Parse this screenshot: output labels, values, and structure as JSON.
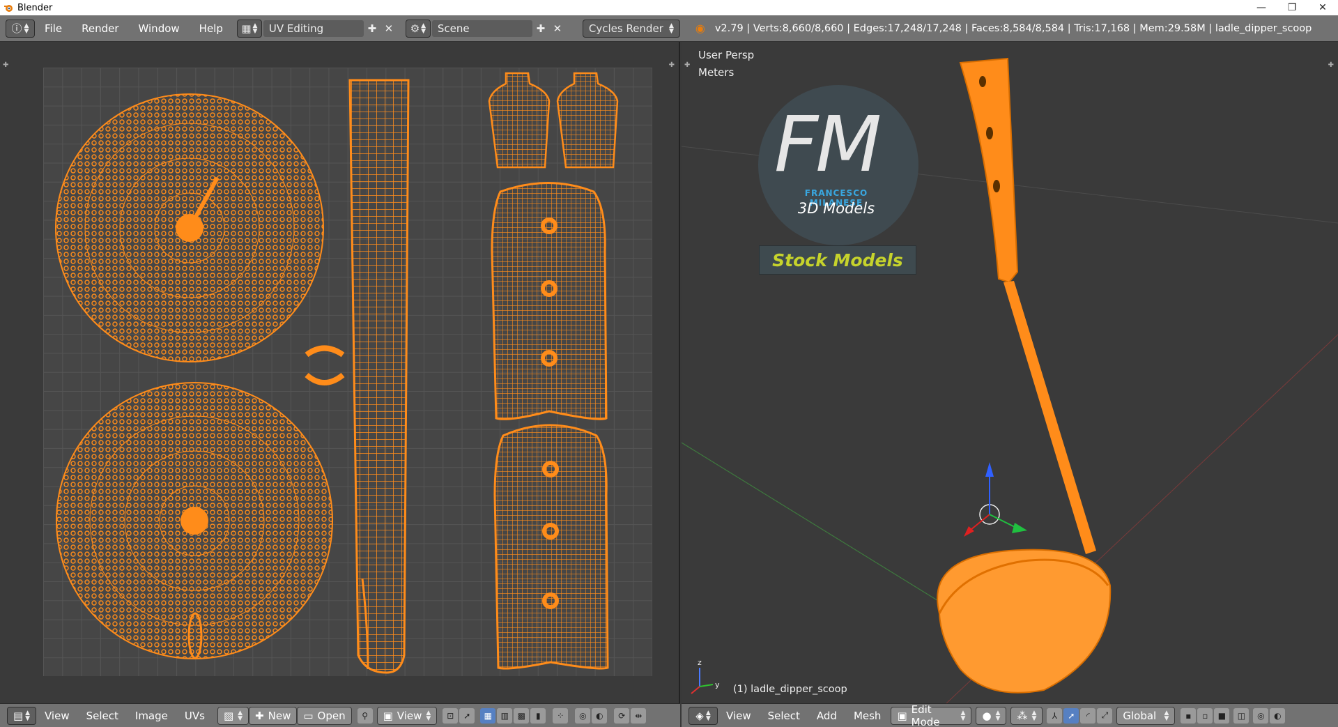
{
  "window": {
    "title": "Blender",
    "min": "—",
    "max": "❐",
    "close": "✕"
  },
  "menu": {
    "file": "File",
    "render": "Render",
    "window": "Window",
    "help": "Help"
  },
  "screen_layout": "UV Editing",
  "scene": "Scene",
  "render_engine": "Cycles Render",
  "stats": "v2.79 | Verts:8,660/8,660 | Edges:17,248/17,248 | Faces:8,584/8,584 | Tris:17,168 | Mem:29.58M | ladle_dipper_scoop",
  "viewport": {
    "persp": "User Persp",
    "units": "Meters",
    "object_label": "(1) ladle_dipper_scoop",
    "watermark": {
      "initials": "FM",
      "name": "FRANCESCO MILANESE",
      "line2": "3D Models",
      "badge": "Stock Models"
    }
  },
  "uv_footer": {
    "view": "View",
    "select": "Select",
    "image": "Image",
    "uvs": "UVs",
    "new": "New",
    "open": "Open",
    "view2": "View"
  },
  "vp_footer": {
    "view": "View",
    "select": "Select",
    "add": "Add",
    "mesh": "Mesh",
    "mode": "Edit Mode",
    "orientation": "Global"
  },
  "colors": {
    "mesh": "#ff8c1a",
    "grid": "#464646",
    "bg": "#3a3a3a",
    "header": "#727272"
  }
}
